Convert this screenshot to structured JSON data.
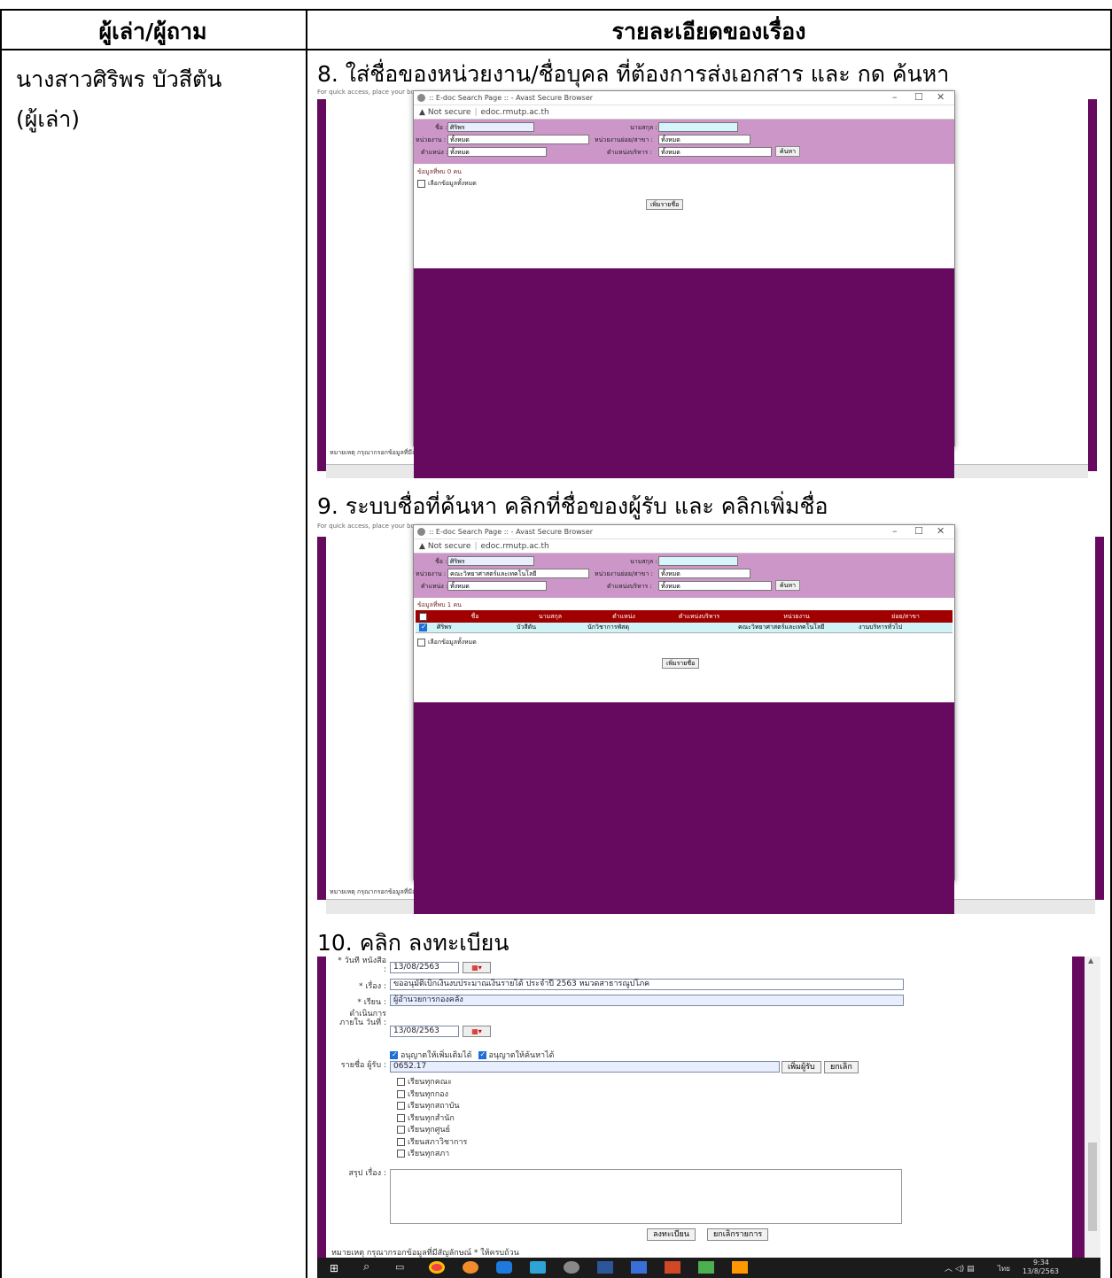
{
  "table": {
    "header_col1": "ผู้เล่า/ผู้ถาม",
    "header_col2": "รายละเอียดของเรื่อง",
    "narrator_name": "นางสาวศิริพร  บัวสีตัน",
    "narrator_role": "(ผู้เล่า)"
  },
  "steps": [
    {
      "text": "8. ใส่ชื่อของหน่วยงาน/ชื่อบุคล ที่ต้องการส่งเอกสาร และ กด ค้นหา"
    },
    {
      "text": "9. ระบบชื่อที่ค้นหา คลิกที่ชื่อของผู้รับ และ คลิกเพิ่มชื่อ"
    },
    {
      "text": "10. คลิก ลงทะเบียน"
    }
  ],
  "shot1": {
    "quick_access": "For quick access, place your boo",
    "window_title": ":: E-doc Search Page :: - Avast Secure Browser",
    "not_secure": "Not secure",
    "url": "edoc.rmutp.ac.th",
    "lbl_name": "ชื่อ :",
    "val_name": "ศิริพร",
    "lbl_surname": "นามสกุล :",
    "val_surname": "",
    "lbl_unit": "หน่วยงาน :",
    "val_unit": "ทั้งหมด",
    "lbl_subunit": "หน่วยงานย่อย/สาขา :",
    "val_subunit": "ทั้งหมด",
    "lbl_position": "ตำแหน่ง :",
    "val_position": "ทั้งหมด",
    "lbl_admin_position": "ตำแหน่งบริหาร :",
    "val_admin_position": "ทั้งหมด",
    "search_btn": "ค้นหา",
    "found": "ข้อมูลที่พบ 0 คน",
    "select_all": "เลือกข้อมูลทั้งหมด",
    "add_btn": "เพิ่มรายชื่อ",
    "footnote": "หมายเหตุ กรุณากรอกข้อมูลที่มีสัญลักษณ์ * ให้ครบถ้วน"
  },
  "shot2": {
    "quick_access": "For quick access, place your boo",
    "window_title": ":: E-doc Search Page :: - Avast Secure Browser",
    "not_secure": "Not secure",
    "url": "edoc.rmutp.ac.th",
    "lbl_name": "ชื่อ :",
    "val_name": "ศิริพร",
    "lbl_surname": "นามสกุล :",
    "val_surname": "",
    "lbl_unit": "หน่วยงาน :",
    "val_unit": "คณะวิทยาศาสตร์และเทคโนโลยี",
    "lbl_subunit": "หน่วยงานย่อย/สาขา :",
    "val_subunit": "ทั้งหมด",
    "lbl_position": "ตำแหน่ง :",
    "val_position": "ทั้งหมด",
    "lbl_admin_position": "ตำแหน่งบริหาร :",
    "val_admin_position": "ทั้งหมด",
    "search_btn": "ค้นหา",
    "found": "ข้อมูลที่พบ 1 คน",
    "columns": [
      "ชื่อ",
      "นามสกุล",
      "ตำแหน่ง",
      "ตำแหน่งบริหาร",
      "หน่วยงาน",
      "ย่อย/สาขา"
    ],
    "row": [
      "ศิริพร",
      "บัวสีตัน",
      "นักวิชาการพัสดุ",
      "",
      "คณะวิทยาศาสตร์และเทคโนโลยี",
      "งานบริหารทั่วไป"
    ],
    "select_all": "เลือกข้อมูลทั้งหมด",
    "add_btn": "เพิ่มรายชื่อ",
    "footnote": "หมายเหตุ กรุณากรอกข้อมูลที่มีสัญลักษณ์ * ให้ครบถ้วน"
  },
  "shot3": {
    "lbl_date": "* วันที่ หนังสือ :",
    "val_date": "13/08/2563",
    "lbl_subject": "* เรื่อง :",
    "val_subject": "ขออนุมัติเบิกเงินงบประมาณเงินรายได้ ประจำปี 2563 หมวดสาธารณูปโภค",
    "lbl_to": "* เรียน :",
    "val_to": "ผู้อำนวยการกองคลัง",
    "lbl_due": "ดำเนินการ ภายใน วันที่ :",
    "val_due": "13/08/2563",
    "allow_add": "อนุญาตให้เพิ่มเติมได้",
    "allow_search": "อนุญาตให้ค้นหาได้",
    "lbl_recipients": "รายชื่อ ผู้รับ :",
    "val_recipients": "0652.17",
    "add_recipient_btn": "เพิ่มผู้รับ",
    "cancel_btn": "ยกเลิก",
    "options": [
      "เรียนทุกคณะ",
      "เรียนทุกกอง",
      "เรียนทุกสถาบัน",
      "เรียนทุกสำนัก",
      "เรียนทุกศูนย์",
      "เรียนสภาวิชาการ",
      "เรียนทุกสภา"
    ],
    "lbl_summary": "สรุป เรื่อง :",
    "register_btn": "ลงทะเบียน",
    "cancel_list_btn": "ยกเลิกรายการ",
    "footnote": "หมายเหตุ กรุณากรอกข้อมูลที่มีสัญลักษณ์ * ให้ครบถ้วน",
    "tray_lang": "ไทย",
    "tray_time": "9:34",
    "tray_date": "13/8/2563"
  }
}
